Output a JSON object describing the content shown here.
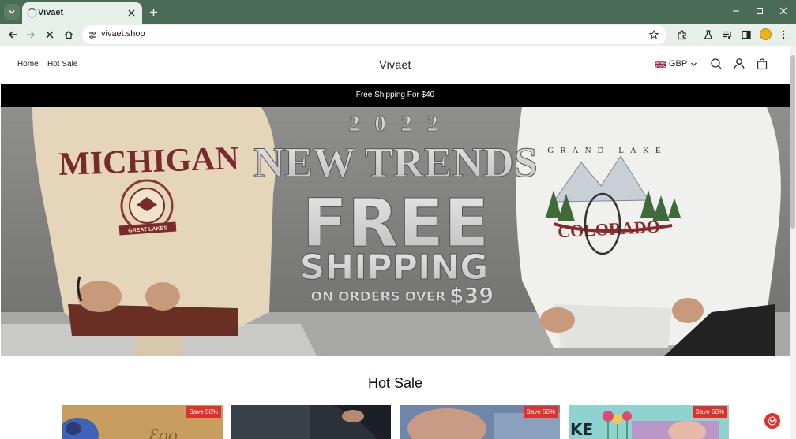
{
  "browser": {
    "tab_title": "Vivaet",
    "url": "vivaet.shop",
    "accent": "#4a6b55"
  },
  "site": {
    "nav": [
      {
        "label": "Home"
      },
      {
        "label": "Hot Sale"
      }
    ],
    "brand": "Vivaet",
    "currency": "GBP",
    "announcement": "Free Shipping For $40"
  },
  "hero": {
    "year": "2 0 2 2",
    "headline": "NEW TRENDS",
    "big": "FREE",
    "shipping": "SHIPPING",
    "orders": "ON ORDERS OVER",
    "price": "$39",
    "left_sweatshirt": "MICHIGAN",
    "left_patch": "GREAT LAKES",
    "right_sweatshirt": "COLORADO",
    "right_top": "GRAND LAKE"
  },
  "hot_sale": {
    "title": "Hot Sale",
    "products": [
      {
        "badge": "Save 50%"
      },
      {
        "badge": ""
      },
      {
        "badge": "Save 50%"
      },
      {
        "badge": "Save 50%"
      }
    ]
  },
  "colors": {
    "sale_red": "#e0302c",
    "announce_bg": "#000000"
  }
}
